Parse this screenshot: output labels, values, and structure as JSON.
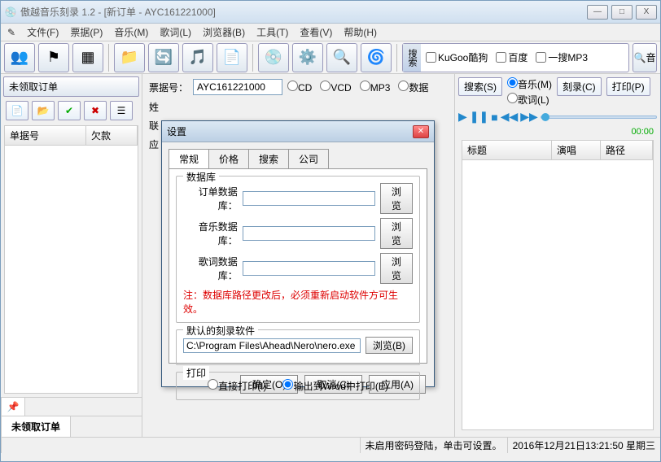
{
  "titlebar": {
    "title": "傲越音乐刻录 1.2 - [新订单 - AYC161221000]"
  },
  "winbuttons": {
    "min": "—",
    "max": "□",
    "close": "X"
  },
  "menu": {
    "file": "文件(F)",
    "receipt": "票据(P)",
    "music": "音乐(M)",
    "lyrics": "歌词(L)",
    "browser": "浏览器(B)",
    "tools": "工具(T)",
    "view": "查看(V)",
    "help": "帮助(H)"
  },
  "search_section": {
    "label": "搜索",
    "kugoo": "KuGoo酷狗",
    "baidu": "百度",
    "yisou": "一搜MP3",
    "btn": "🔍音"
  },
  "left": {
    "header": "未领取订单",
    "cols": {
      "no": "单据号",
      "debt": "欠款"
    },
    "tab": "未领取订单"
  },
  "mid": {
    "ticket_label": "票据号：",
    "ticket_value": "AYC161221000",
    "radios": {
      "cd": "CD",
      "vcd": "VCD",
      "mp3": "MP3",
      "data": "数据"
    }
  },
  "right": {
    "search_btn": "搜索(S)",
    "music_radio": "音乐(M)",
    "lyrics_radio": "歌词(L)",
    "burn_btn": "刻录(C)",
    "print_btn": "打印(P)",
    "time": "00:00",
    "cols": {
      "title": "标题",
      "singer": "演唱",
      "path": "路径"
    }
  },
  "status": {
    "msg": "未启用密码登陆，单击可设置。",
    "datetime": "2016年12月21日13:21:50  星期三"
  },
  "dialog": {
    "title": "设置",
    "tabs": {
      "general": "常规",
      "price": "价格",
      "search": "搜索",
      "company": "公司"
    },
    "grp_db": "数据库",
    "db_order": "订单数据库：",
    "db_music": "音乐数据库：",
    "db_lyrics": "歌词数据库：",
    "browse": "浏览",
    "warn": "注：数据库路径更改后，必须重新启动软件方可生效。",
    "grp_burn": "默认的刻录软件",
    "burn_path": "C:\\Program Files\\Ahead\\Nero\\nero.exe",
    "browse_b": "浏览(B)",
    "grp_print": "打印",
    "print_direct": "直接打印(I)",
    "print_word": "输出到Wrod中打印(E)",
    "ok": "确定(O)",
    "cancel": "取消(C)",
    "apply": "应用(A)"
  }
}
